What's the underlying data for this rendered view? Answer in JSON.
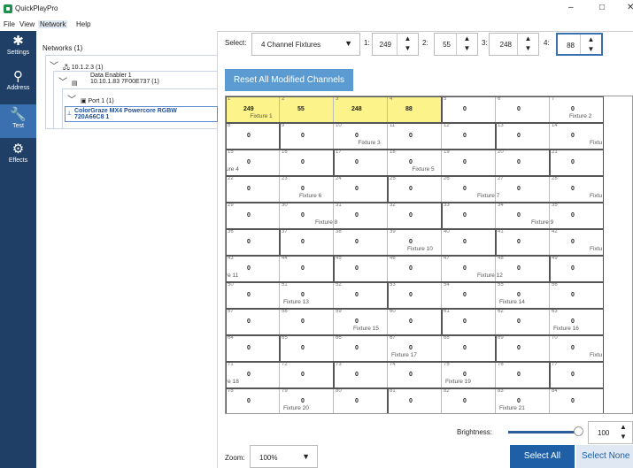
{
  "app": {
    "title": "QuickPlayPro",
    "minimize": "–",
    "maximize": "□",
    "close": "✕"
  },
  "menu": [
    "File",
    "View",
    "Network",
    "Help"
  ],
  "nav": [
    {
      "label": "Settings",
      "icon": "gear-icon",
      "glyph": "✱"
    },
    {
      "label": "Address",
      "icon": "location-pin-icon",
      "glyph": "⚲"
    },
    {
      "label": "Test",
      "icon": "wrench-icon",
      "glyph": "🔧"
    },
    {
      "label": "Effects",
      "icon": "effects-icon",
      "glyph": "⚙"
    }
  ],
  "tree": {
    "root": "Networks (1)",
    "net": "10.1.2.3 (1)",
    "enabler_1": "Data Enabler 1",
    "enabler_2": "10.10.1.83 7F00E737 (1)",
    "port": "Port 1 (1)",
    "fixture_1": "ColorGraze MX4 Powercore RGBW",
    "fixture_2": "720A66C8 1"
  },
  "controls": {
    "select_label": "Select:",
    "select_value": "4 Channel Fixtures",
    "ch1_label": "1:",
    "ch1_value": "249",
    "ch2_label": "2:",
    "ch2_value": "55",
    "ch3_label": "3:",
    "ch3_value": "248",
    "ch4_label": "4:",
    "ch4_value": "88",
    "reset_label": "Reset All Modified Channels",
    "brightness_label": "Brightness:",
    "brightness_value": "100",
    "brightness_level": 1.0,
    "zoom_label": "Zoom:",
    "zoom_value": "100%",
    "select_all": "Select All",
    "select_none": "Select None"
  },
  "grid": {
    "values": {
      "1": "249",
      "2": "55",
      "3": "248",
      "4": "88"
    },
    "default_value": "0",
    "channel_count": 84,
    "fixture_labels": [
      "Fixture 1",
      "Fixture 2",
      "Fixture 3",
      "ure 4",
      "Fixture 5",
      "Fixture 6",
      "Fixture 7",
      "Fixture 8",
      "Fixture 9",
      "Fixture 10",
      "Fixtu",
      "re 11",
      "Fixture 12",
      "Fixture 13",
      "Fixture 14",
      "Fixture 15",
      "Fixture 16",
      "Fixture 17",
      "Fixtu",
      "re 18",
      "Fixture 19",
      "Fixture 20",
      "Fixture 21",
      "Fixtu",
      "Fixtu"
    ],
    "highlight_color": "#fcf38a"
  },
  "colors": {
    "nav_bg": "#1f3f66",
    "nav_active": "#3a70b0",
    "accent": "#1f5fa5"
  }
}
